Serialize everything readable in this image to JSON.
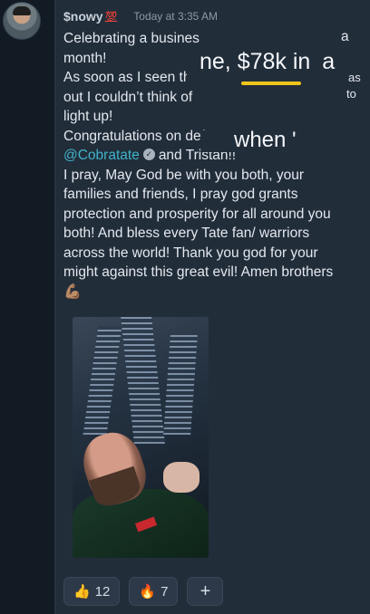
{
  "message": {
    "username": "$nowy",
    "username_badge": "💯",
    "timestamp": "Today at 3:35 AM",
    "lines": [
      "Celebrating a busines",
      "month!",
      "As soon as I seen th",
      "out I couldn’t think of",
      "light up!",
      "Congratulations on defea"
    ],
    "line_fragments": {
      "line1_end": "a",
      "line3_end": "as",
      "line4_end": "to"
    },
    "mention": "@Cobratate",
    "verified_icon": "verified-badge-icon",
    "after_mention": "and Tristan!!",
    "body_lines": [
      "I pray, May God be with you both, your",
      "families and friends, I pray god grants",
      "protection and prosperity for all around you",
      "both! And bless every Tate fan/ warriors",
      "across the world! Thank you god for your",
      "might against this great evil! Amen brothers"
    ],
    "end_emoji": "💪🏽"
  },
  "overlay": {
    "caption": "ne, $78k in",
    "caption_tail": "a",
    "caption2": "when '"
  },
  "reactions": [
    {
      "emoji": "👍",
      "count": "12"
    },
    {
      "emoji": "🔥",
      "count": "7"
    }
  ],
  "add_reaction_label": "+",
  "colors": {
    "background": "#1c2633",
    "card": "#222d3a",
    "mention": "#3fb3c9",
    "highlight_underline": "#f0c419"
  }
}
